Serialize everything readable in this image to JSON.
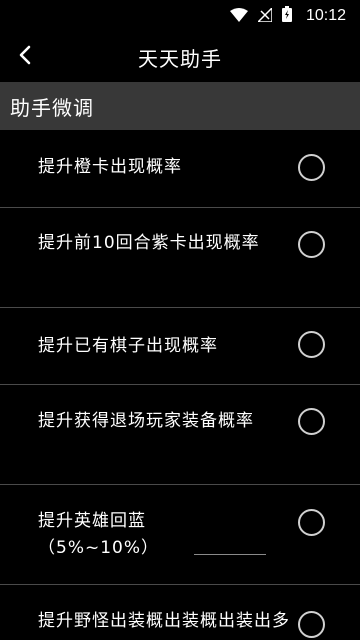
{
  "status_bar": {
    "time": "10:12",
    "icons": [
      "wifi-icon",
      "signal-icon",
      "battery-icon"
    ]
  },
  "app_bar": {
    "back_icon": "chevron-left-icon",
    "title": "天天助手"
  },
  "section": {
    "title": "助手微调"
  },
  "options": [
    {
      "label": "提升橙卡出现概率",
      "checked": false
    },
    {
      "label": "提升前10回合紫卡出现概率",
      "checked": false
    },
    {
      "label": "提升已有棋子出现概率",
      "checked": false
    },
    {
      "label": "提升获得退场玩家装备概率",
      "checked": false
    },
    {
      "label": "提升英雄回蓝",
      "sub_label": "（5%~10%）",
      "checked": false
    },
    {
      "label": "提升野怪出装概出装概出装出多",
      "checked": false
    }
  ],
  "colors": {
    "background": "#000000",
    "section_header": "#383838",
    "divider": "#4a4a4a"
  }
}
